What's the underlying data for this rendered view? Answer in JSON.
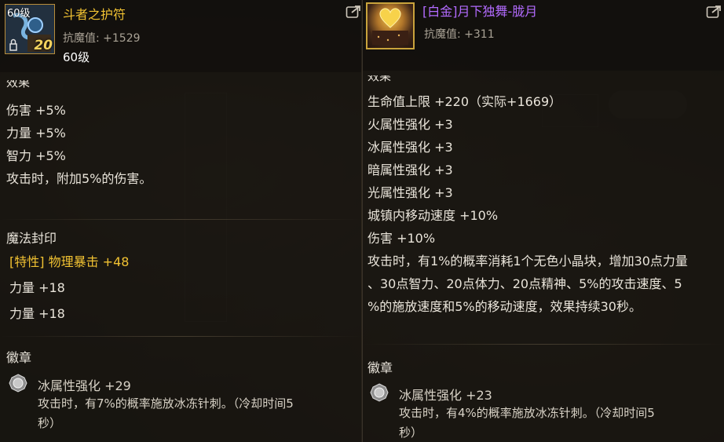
{
  "left": {
    "level_badge": "60级",
    "icon_number": "20",
    "name": "斗者之护符",
    "stat": "抗魔值: +1529",
    "level": "60级",
    "effect_title": "效果",
    "effects": [
      "伤害 +5%",
      "力量 +5%",
      "智力 +5%",
      "攻击时，附加5%的伤害。"
    ],
    "magic_seal": {
      "title": "魔法封印",
      "lines": [
        "[特性] 物理暴击 +48",
        "力量 +18",
        "力量 +18"
      ]
    },
    "emblem": {
      "title": "徽章",
      "stat": "冰属性强化 +29",
      "desc_line1": "攻击时，有7%的概率施放冰冻针刺。（冷却时间5",
      "desc_line2": "秒）"
    }
  },
  "right": {
    "name": "[白金]月下独舞-胧月",
    "stat": "抗魔值: +311",
    "effect_title": "效果",
    "effects": [
      "生命值上限 +220（实际+1669）",
      "火属性强化 +3",
      "冰属性强化 +3",
      "暗属性强化 +3",
      "光属性强化 +3",
      "城镇内移动速度 +10%",
      "伤害 +10%",
      "攻击时，有1%的概率消耗1个无色小晶块，增加30点力量",
      "、30点智力、20点体力、20点精神、5%的攻击速度、5",
      "%的施放速度和5%的移动速度，效果持续30秒。"
    ],
    "emblem": {
      "title": "徽章",
      "stat": "冰属性强化 +23",
      "desc_line1": "攻击时，有4%的概率施放冰冻针刺。（冷却时间5",
      "desc_line2": "秒）"
    }
  },
  "colors": {
    "legendary_gold": "#f1c232",
    "platinum_purple": "#b36bff",
    "text": "#e9e4da",
    "muted": "#a9a295"
  }
}
